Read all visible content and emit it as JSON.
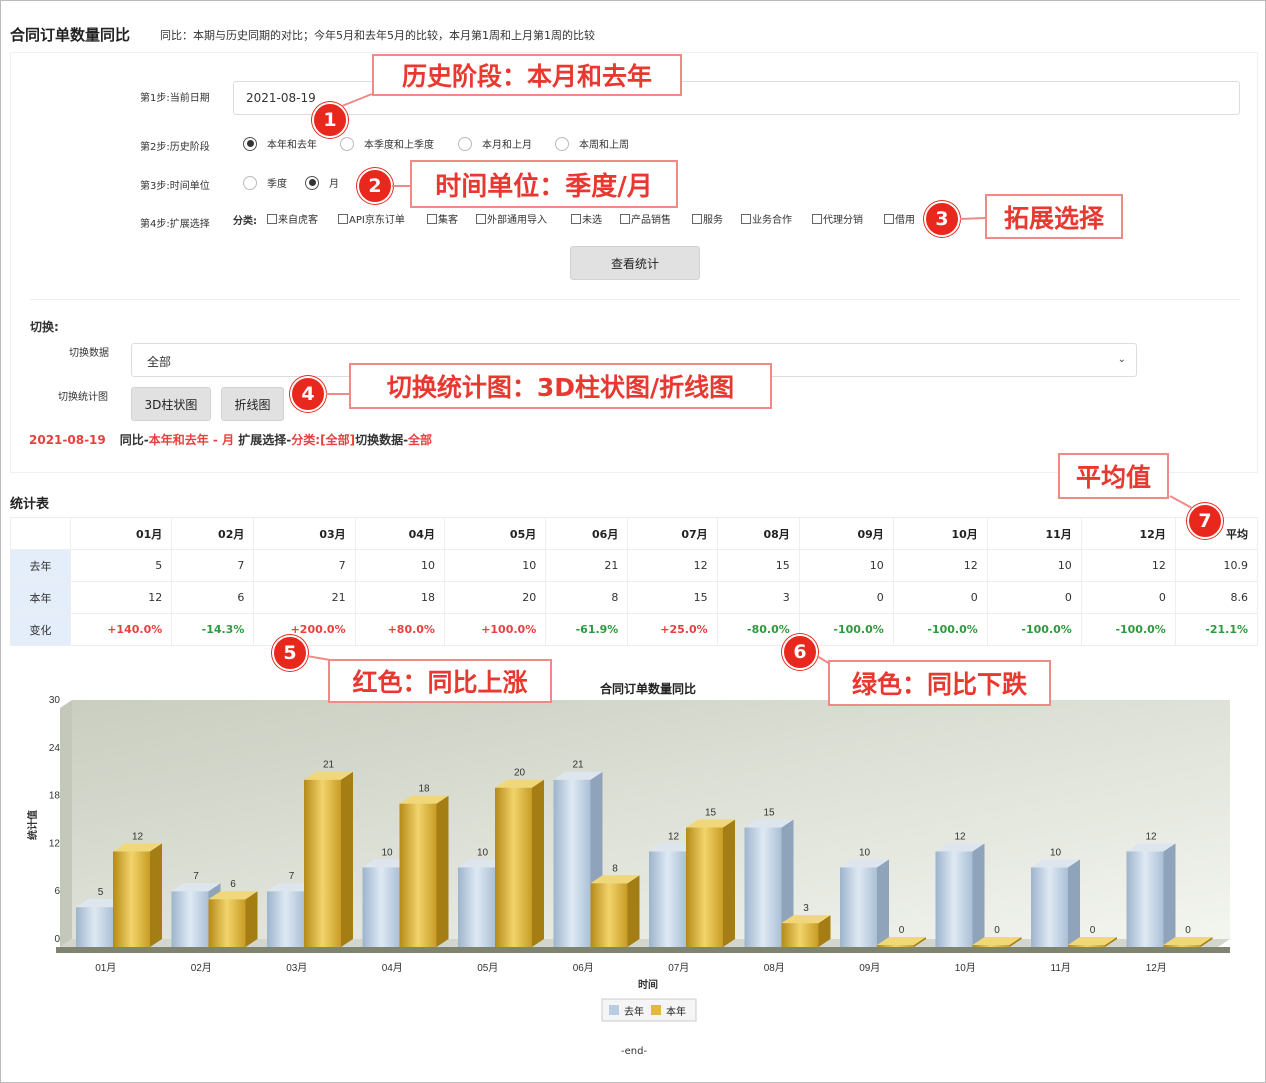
{
  "header": {
    "title": "合同订单数量同比",
    "description": "同比：本期与历史同期的对比；今年5月和去年5月的比较，本月第1周和上月第1周的比较"
  },
  "form": {
    "step1_label": "第1步:当前日期",
    "date_value": "2021-08-19",
    "step2_label": "第2步:历史阶段",
    "history_options": [
      {
        "label": "本年和去年",
        "checked": true
      },
      {
        "label": "本季度和上季度",
        "checked": false
      },
      {
        "label": "本月和上月",
        "checked": false
      },
      {
        "label": "本周和上周",
        "checked": false
      }
    ],
    "step3_label": "第3步:时间单位",
    "unit_options": [
      {
        "label": "季度",
        "checked": false
      },
      {
        "label": "月",
        "checked": true
      }
    ],
    "step4_label": "第4步:扩展选择",
    "category_label": "分类:",
    "categories": [
      "来自虎客",
      "API京东订单",
      "集客",
      "外部通用导入",
      "未选",
      "产品销售",
      "服务",
      "业务合作",
      "代理分销",
      "借用"
    ],
    "submit_label": "查看统计"
  },
  "switch": {
    "title": "切换:",
    "data_label": "切换数据",
    "data_value": "全部",
    "chart_label": "切换统计图",
    "bar3d_label": "3D柱状图",
    "line_label": "折线图"
  },
  "summary": {
    "date": "2021-08-19",
    "p1": "同比-",
    "p2": "本年和去年 - 月",
    "p3": " 扩展选择-",
    "p4": "分类:",
    "p5": "[全部]",
    "p6": "切换数据-",
    "p7": "全部"
  },
  "annotations": {
    "a1": "历史阶段：本月和去年",
    "a2": "时间单位：季度/月",
    "a3": "拓展选择",
    "a4": "切换统计图：3D柱状图/折线图",
    "a5": "红色：同比上涨",
    "a6": "绿色：同比下跌",
    "a7": "平均值",
    "n1": "1",
    "n2": "2",
    "n3": "3",
    "n4": "4",
    "n5": "5",
    "n6": "6",
    "n7": "7"
  },
  "table": {
    "title": "统计表",
    "headers": [
      "01月",
      "02月",
      "03月",
      "04月",
      "05月",
      "06月",
      "07月",
      "08月",
      "09月",
      "10月",
      "11月",
      "12月",
      "平均"
    ],
    "rows": [
      {
        "label": "去年",
        "cells": [
          "5",
          "7",
          "7",
          "10",
          "10",
          "21",
          "12",
          "15",
          "10",
          "12",
          "10",
          "12",
          "10.9"
        ]
      },
      {
        "label": "本年",
        "cells": [
          "12",
          "6",
          "21",
          "18",
          "20",
          "8",
          "15",
          "3",
          "0",
          "0",
          "0",
          "0",
          "8.6"
        ]
      },
      {
        "label": "变化",
        "cells": [
          "+140.0%",
          "-14.3%",
          "+200.0%",
          "+80.0%",
          "+100.0%",
          "-61.9%",
          "+25.0%",
          "-80.0%",
          "-100.0%",
          "-100.0%",
          "-100.0%",
          "-100.0%",
          "-21.1%"
        ]
      }
    ]
  },
  "chart_data": {
    "type": "bar",
    "title": "合同订单数量同比",
    "xlabel": "时间",
    "ylabel": "统计值",
    "categories": [
      "01月",
      "02月",
      "03月",
      "04月",
      "05月",
      "06月",
      "07月",
      "08月",
      "09月",
      "10月",
      "11月",
      "12月"
    ],
    "series": [
      {
        "name": "去年",
        "values": [
          5,
          7,
          7,
          10,
          10,
          21,
          12,
          15,
          10,
          12,
          10,
          12
        ],
        "color": "#b8cde2"
      },
      {
        "name": "本年",
        "values": [
          12,
          6,
          21,
          18,
          20,
          8,
          15,
          3,
          0,
          0,
          0,
          0
        ],
        "color": "#e2b840"
      }
    ],
    "yticks": [
      0,
      6,
      12,
      18,
      24,
      30
    ],
    "ylim": [
      0,
      30
    ],
    "grid": false,
    "legend": "bottom"
  },
  "footer": {
    "end": "-end-"
  },
  "colors": {
    "up": "#e8403d",
    "down": "#2e9a3e",
    "annotation": "#e83830"
  }
}
